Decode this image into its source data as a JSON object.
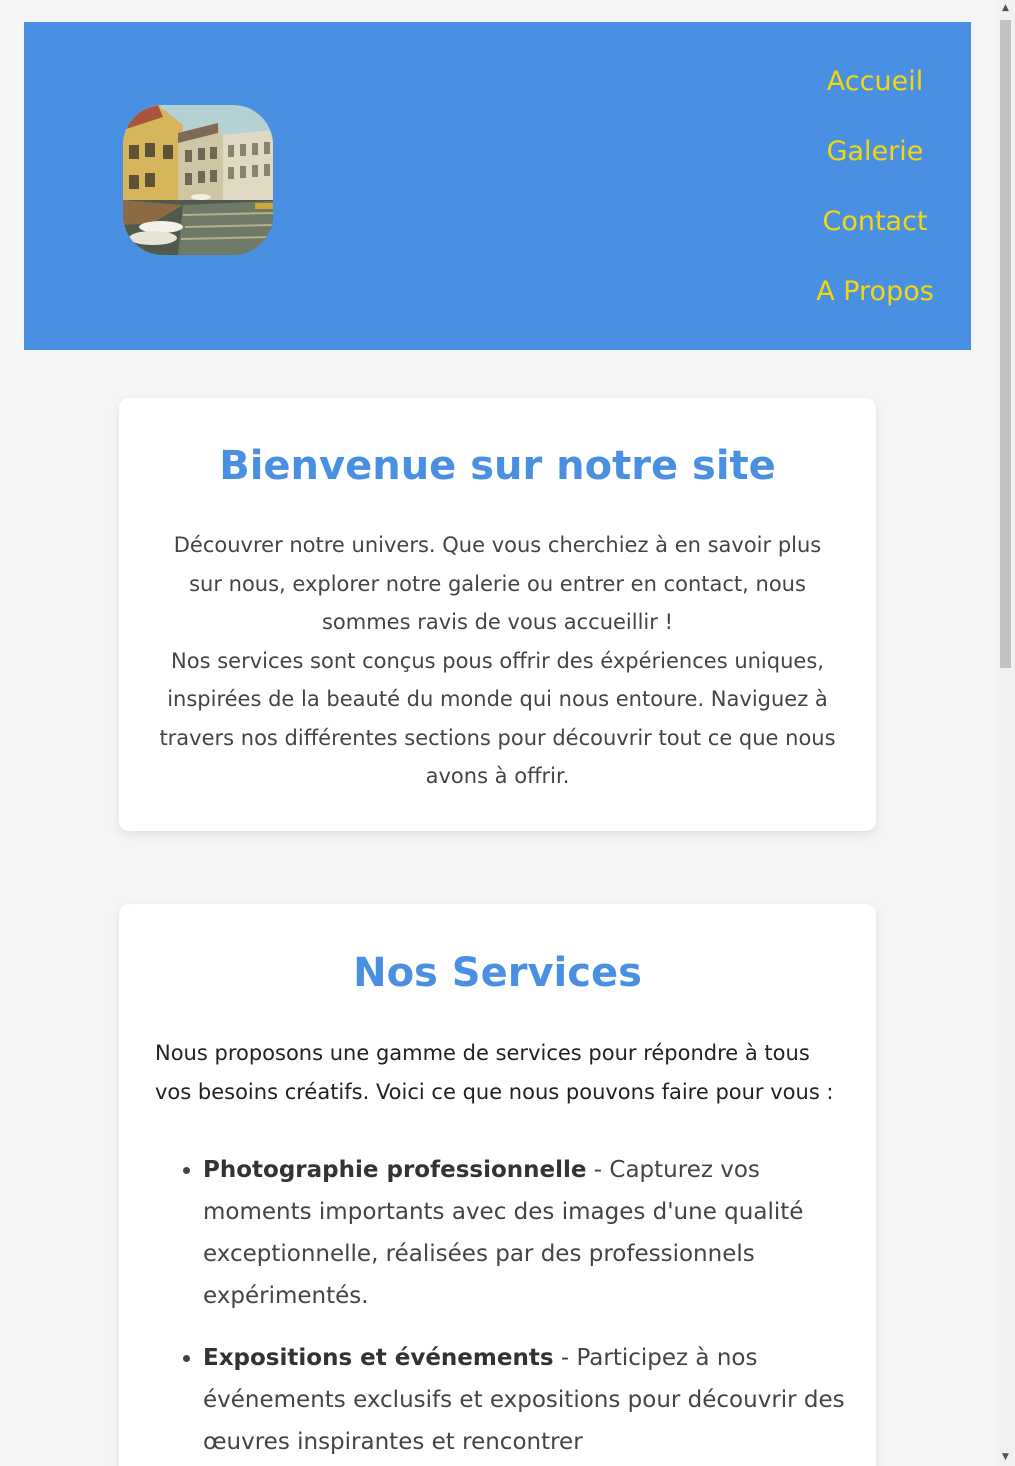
{
  "header": {
    "logo_alt": "canal-town-photo",
    "nav": [
      {
        "label": "Accueil"
      },
      {
        "label": "Galerie"
      },
      {
        "label": "Contact"
      },
      {
        "label": "A Propos"
      }
    ]
  },
  "welcome": {
    "title": "Bienvenue sur notre site",
    "paragraph1": "Découvrer notre univers. Que vous cherchiez à en savoir plus sur nous, explorer notre galerie ou entrer en contact, nous sommes ravis de vous accueillir !",
    "paragraph2": "Nos services sont conçus pous offrir des éxpériences uniques, inspirées de la beauté du monde qui nous entoure. Naviguez à travers nos différentes sections pour découvrir tout ce que nous avons à offrir."
  },
  "services": {
    "title": "Nos Services",
    "intro": "Nous proposons une gamme de services pour répondre à tous vos besoins créatifs. Voici ce que nous pouvons faire pour vous :",
    "items": [
      {
        "name": "Photographie professionnelle",
        "description": " - Capturez vos moments importants avec des images d'une qualité exceptionnelle, réalisées par des professionnels expérimentés."
      },
      {
        "name": "Expositions et événements",
        "description": " - Participez à nos événements exclusifs et expositions pour découvrir des œuvres inspirantes et rencontrer"
      }
    ]
  },
  "colors": {
    "header_bg": "#4a90e2",
    "nav_text": "#f5d60e",
    "title": "#4a90e2"
  },
  "scrollbar": {
    "up_icon": "arrow-up-icon",
    "down_icon": "arrow-down-icon"
  }
}
